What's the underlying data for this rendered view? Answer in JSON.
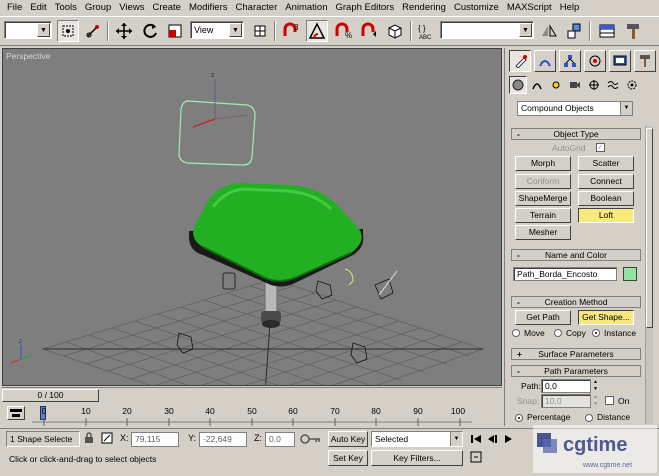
{
  "menu": [
    "File",
    "Edit",
    "Tools",
    "Group",
    "Views",
    "Create",
    "Modifiers",
    "Character",
    "Animation",
    "Graph Editors",
    "Rendering",
    "Customize",
    "MAXScript",
    "Help"
  ],
  "toolbar": {
    "undo_select_value": "",
    "view_select_value": "View",
    "named_selection_value": "",
    "icons": [
      "select-object-icon",
      "select-region-icon",
      "select-by-name-icon",
      "select-move-icon",
      "select-rotate-icon",
      "select-scale-icon",
      "use-pivot-icon",
      "snap-3d-icon",
      "angle-snap-icon",
      "percent-snap-icon",
      "spinner-snap-icon",
      "mirror-icon",
      "align-icon",
      "layer-manager-icon",
      "curve-editor-icon",
      "schematic-view-icon",
      "material-editor-icon",
      "render-scene-icon",
      "quick-render-icon"
    ]
  },
  "viewport": {
    "label": "Perspective",
    "background": "#7e7e7e",
    "seat_color": "#22b022"
  },
  "command_panel": {
    "tabs": [
      "create-tab",
      "modify-tab",
      "hierarchy-tab",
      "motion-tab",
      "display-tab",
      "utilities-tab"
    ],
    "subcategory": "Compound Objects",
    "object_type": {
      "title": "Object Type",
      "autogrid_label": "AutoGrid",
      "autogrid_checked": "✓",
      "buttons": [
        "Morph",
        "Scatter",
        "Conform",
        "Connect",
        "ShapeMerge",
        "Boolean",
        "Terrain",
        "Loft",
        "Mesher"
      ]
    },
    "name_and_color": {
      "title": "Name and Color",
      "name_value": "Path_Borda_Encosto",
      "color": "#8ee6a0"
    },
    "creation_method": {
      "title": "Creation Method",
      "get_path": "Get Path",
      "get_shape": "Get Shape...",
      "move": "Move",
      "copy": "Copy",
      "instance": "Instance"
    },
    "surface_parameters": {
      "title": "Surface Parameters",
      "sign": "+"
    },
    "path_parameters": {
      "title": "Path Parameters",
      "path_label": "Path:",
      "path_value": "0,0",
      "snap_label": "Snap:",
      "snap_value": "10,0",
      "on_label": "On",
      "percentage": "Percentage",
      "distance": "Distance"
    },
    "collapse_sign": "-"
  },
  "timeline": {
    "frame_display": "0 / 100",
    "ticks": [
      "0",
      "10",
      "20",
      "30",
      "40",
      "50",
      "60",
      "70",
      "80",
      "90",
      "100"
    ]
  },
  "status": {
    "selection": "1 Shape Selecte",
    "x_label": "X:",
    "x_value": "79,115",
    "y_label": "Y:",
    "y_value": "-22,649",
    "z_label": "Z:",
    "z_value": "0,0",
    "auto_key": "Auto Key",
    "set_key": "Set Key",
    "selected": "Selected",
    "key_filters": "Key Filters...",
    "prompt": "Click or click-and-drag to select objects"
  },
  "watermark": {
    "brand": "cgtime",
    "url": "www.cgtime.net"
  }
}
